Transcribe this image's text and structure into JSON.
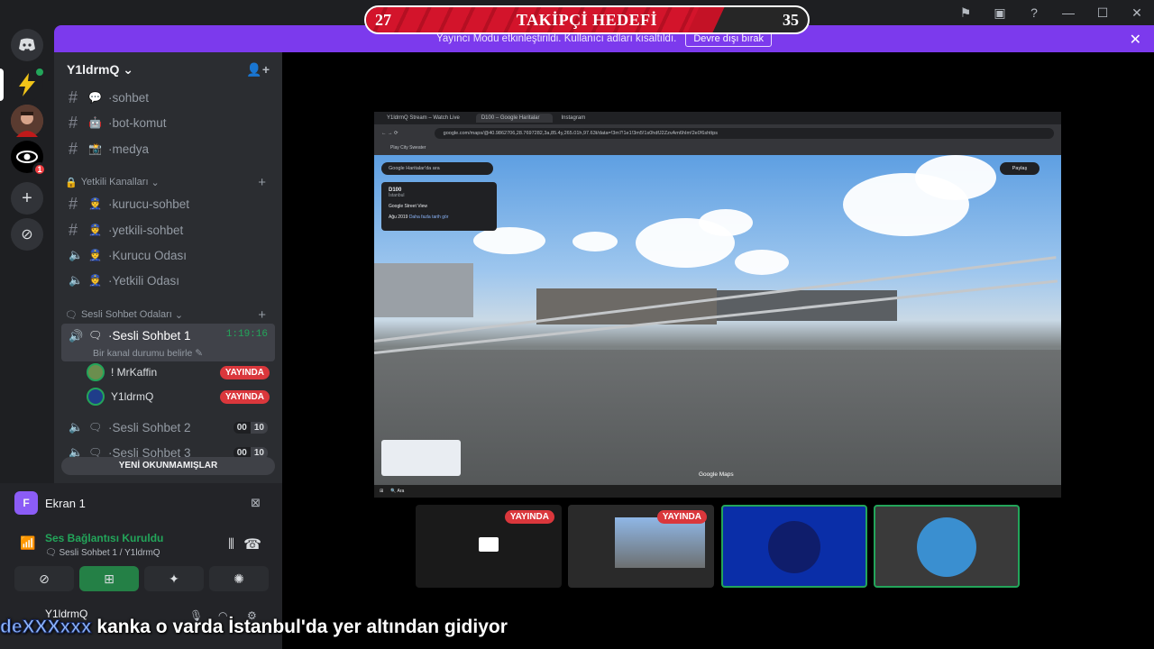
{
  "goal": {
    "title": "TAKİPÇİ HEDEFİ",
    "current": "27",
    "target": "35",
    "progress": 0.77
  },
  "notice": {
    "text": "Yayıncı Modu etkinleştirildi. Kullanıcı adları kısaltıldı.",
    "button": "Devre dışı bırak"
  },
  "guild": {
    "name": "Y1ldrmQ"
  },
  "channels": {
    "text": [
      {
        "name": "sohbet",
        "emoji": "💬"
      },
      {
        "name": "bot-komut",
        "emoji": "🤖"
      },
      {
        "name": "medya",
        "emoji": "📸"
      }
    ],
    "staff_category": "Yetkili Kanalları",
    "staff": [
      {
        "name": "kurucu-sohbet",
        "emoji": "👮",
        "type": "text"
      },
      {
        "name": "yetkili-sohbet",
        "emoji": "👮",
        "type": "text"
      },
      {
        "name": "Kurucu Odası",
        "emoji": "👮",
        "type": "voice"
      },
      {
        "name": "Yetkili Odası",
        "emoji": "👮",
        "type": "voice"
      }
    ],
    "voice_category": "Sesli Sohbet Odaları",
    "voice": [
      {
        "name": "Sesli Sohbet 1",
        "timer": "1:19:16",
        "status": "Bir kanal durumu belirle"
      },
      {
        "name": "Sesli Sohbet 2",
        "count_a": "00",
        "count_b": "10"
      },
      {
        "name": "Sesli Sohbet 3",
        "count_a": "00",
        "count_b": "10"
      }
    ],
    "voice_users": [
      {
        "name": "! MrKaffin",
        "badge": "YAYINDA"
      },
      {
        "name": "Y1ldrmQ",
        "badge": "YAYINDA"
      }
    ],
    "unread_label": "YENİ OKUNMAMIŞLAR"
  },
  "panel": {
    "screen_letter": "F",
    "screen_title": "Ekran 1",
    "connection": "Ses Bağlantısı Kuruldu",
    "connection_sub": "Sesli Sohbet 1 / Y1ldrmQ",
    "username": "Y1ldrmQ"
  },
  "browser": {
    "tabs": [
      "Y1ldrmQ Stream – Watch Live",
      "D100 – Google Haritalar",
      "Instagram"
    ],
    "url": "google.com/maps/@40.9862706,28.7697282,3a,85.4y,265.01h,97.63t/data=!3m7!1e1!3m5!1s0hdfJ2ZzvAm6hIm!2e0!6shttps",
    "bookmark": "Play City Sweater",
    "search_placeholder": "Google Haritalar'da ara",
    "place_title": "D100",
    "place_sub": "İstanbul",
    "place_source": "Google Street View",
    "place_date": "Ağu 2019",
    "place_more": "Daha fazla tarih gör",
    "share": "Paylaş",
    "maps_label": "Google Maps",
    "taskbar_search": "Ara"
  },
  "thumbs": [
    {
      "badge": "YAYINDA"
    },
    {
      "badge": "YAYINDA"
    }
  ],
  "caption": {
    "name": "deXXXxxx",
    "text": "kanka o varda İstanbul'da yer altından gidiyor"
  }
}
